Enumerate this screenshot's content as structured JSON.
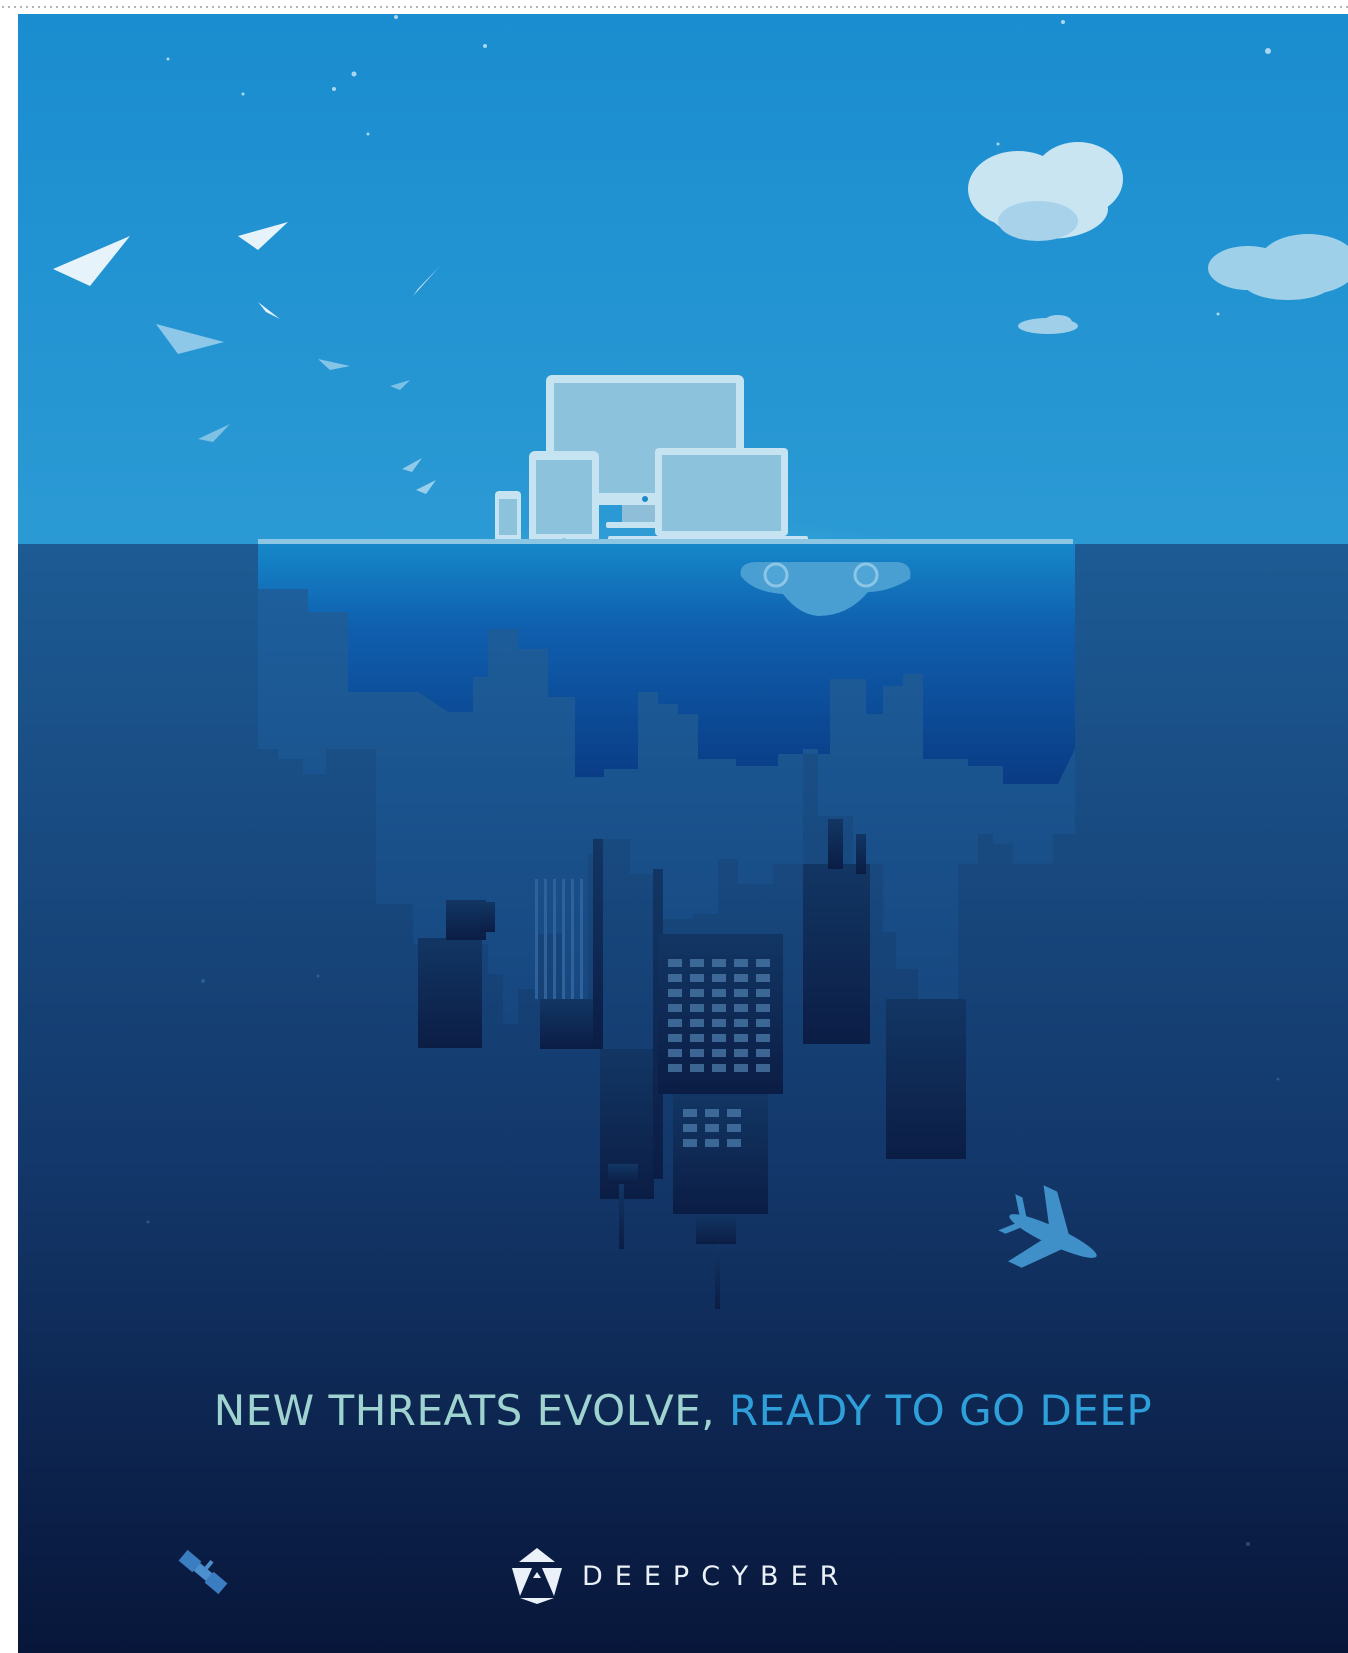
{
  "headline": {
    "part1": "NEW THREATS EVOLVE,",
    "part2": "READY TO GO DEEP"
  },
  "brand": {
    "name": "DEEPCYBER",
    "logo_icon": "deepcyber-logo-icon"
  },
  "colors": {
    "sky_top": "#1a8fd0",
    "sky_horizon": "#5cb0de",
    "ocean_top": "#1c5a92",
    "ocean_bottom": "#09183a",
    "headline_light": "#9fd3cf",
    "headline_accent": "#2f9fda",
    "brand_text": "#e9f0f7"
  },
  "icons": [
    "cloud-icon",
    "bird-icon",
    "monitor-icon",
    "tablet-icon",
    "phone-icon",
    "laptop-icon",
    "car-icon",
    "airplane-icon",
    "satellite-icon",
    "city-skyline-icon"
  ]
}
